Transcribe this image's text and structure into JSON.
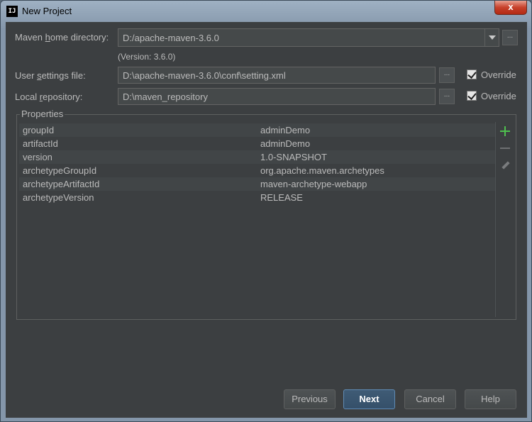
{
  "window": {
    "title": "New Project",
    "close_label": "x",
    "app_icon_text": "IJ"
  },
  "maven_home": {
    "label": "Maven home directory:",
    "value": "D:/apache-maven-3.6.0",
    "version": "(Version: 3.6.0)"
  },
  "user_settings": {
    "label": "User settings file:",
    "value": "D:\\apache-maven-3.6.0\\conf\\setting.xml",
    "override_label": "Override",
    "override_checked": true
  },
  "local_repo": {
    "label": "Local repository:",
    "value": "D:\\maven_repository",
    "override_label": "Override",
    "override_checked": true
  },
  "browse_label": "...",
  "properties": {
    "title": "Properties",
    "rows": [
      {
        "key": "groupId",
        "value": "adminDemo"
      },
      {
        "key": "artifactId",
        "value": "adminDemo"
      },
      {
        "key": "version",
        "value": "1.0-SNAPSHOT"
      },
      {
        "key": "archetypeGroupId",
        "value": "org.apache.maven.archetypes"
      },
      {
        "key": "archetypeArtifactId",
        "value": "maven-archetype-webapp"
      },
      {
        "key": "archetypeVersion",
        "value": "RELEASE"
      }
    ],
    "tools": [
      "plus-icon",
      "minus-icon",
      "pencil-icon"
    ]
  },
  "buttons": {
    "previous": "Previous",
    "next": "Next",
    "cancel": "Cancel",
    "help": "Help"
  },
  "colors": {
    "background": "#3c3f41",
    "field": "#45494a",
    "text": "#bbbbbb",
    "accent_add": "#4ec04e",
    "default_button": "#3f5b75"
  }
}
